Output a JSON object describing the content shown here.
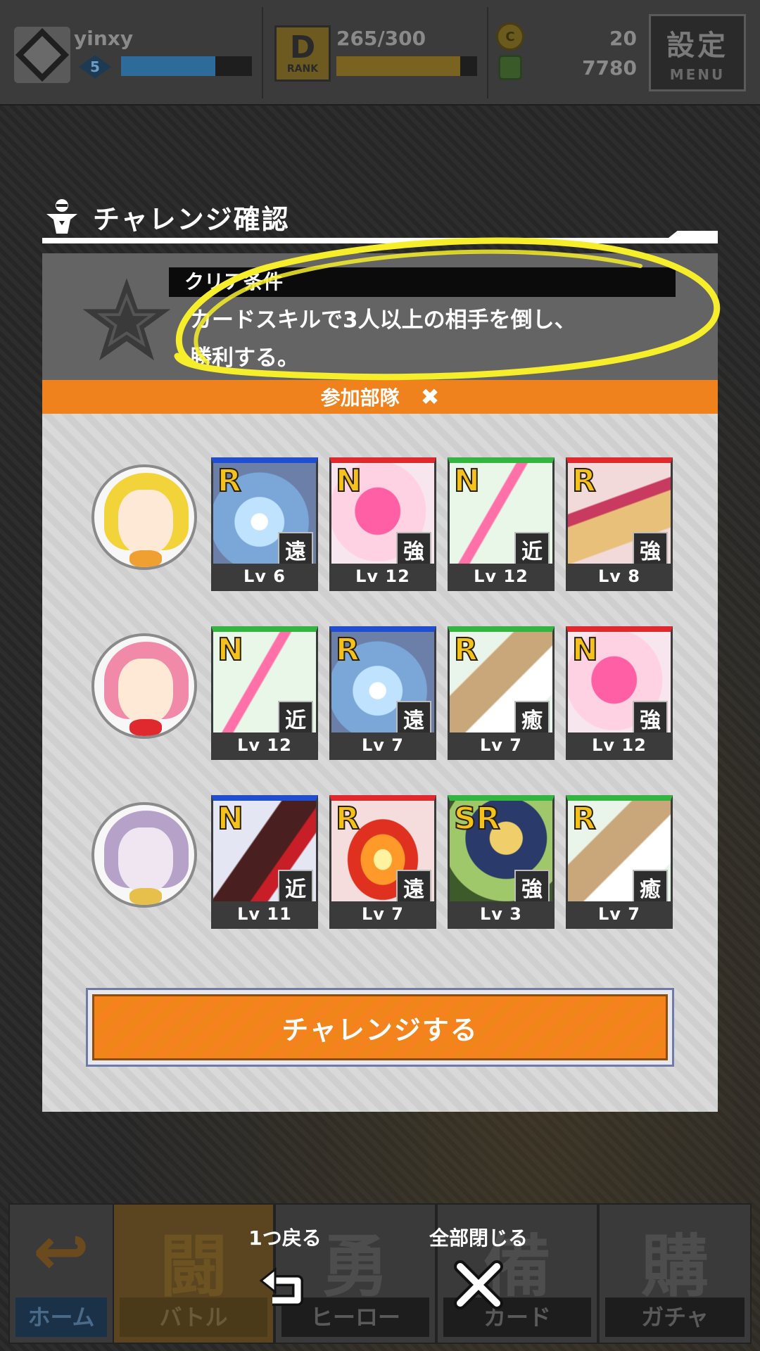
{
  "header": {
    "user_name": "yinxy",
    "level": "5",
    "level_progress": 0.72,
    "rank_glyph": "D",
    "rank_label": "RANK",
    "stamina": "265/300",
    "stamina_progress": 0.88,
    "coin_symbol": "C",
    "coins": "20",
    "gems": "7780",
    "settings_label": "設定",
    "menu_label": "MENU"
  },
  "dialog": {
    "title": "チャレンジ確認",
    "condition_header": "クリア条件",
    "condition_line1": "カードスキルで3人以上の相手を倒し、",
    "condition_line2": "勝利する。",
    "party_strip_label": "参加部隊",
    "party_strip_close": "✖",
    "challenge_button": "チャレンジする"
  },
  "team": [
    {
      "hero": "yellow-hooded-hero",
      "cards": [
        {
          "rarity": "R",
          "type": "遠",
          "level": "Lv 6",
          "color": "#1f4fd0",
          "art": "ice-shards"
        },
        {
          "rarity": "N",
          "type": "強",
          "level": "Lv 12",
          "color": "#e0282f",
          "art": "pink-umbrella"
        },
        {
          "rarity": "N",
          "type": "近",
          "level": "Lv 12",
          "color": "#33b540",
          "art": "magic-wand"
        },
        {
          "rarity": "R",
          "type": "強",
          "level": "Lv 8",
          "color": "#e0282f",
          "art": "cleaning-tools"
        }
      ]
    },
    {
      "hero": "pink-haired-hero",
      "cards": [
        {
          "rarity": "N",
          "type": "近",
          "level": "Lv 12",
          "color": "#33b540",
          "art": "magic-wand"
        },
        {
          "rarity": "R",
          "type": "遠",
          "level": "Lv 7",
          "color": "#1f4fd0",
          "art": "ice-shards"
        },
        {
          "rarity": "R",
          "type": "癒",
          "level": "Lv 7",
          "color": "#33b540",
          "art": "medical-kit"
        },
        {
          "rarity": "N",
          "type": "強",
          "level": "Lv 12",
          "color": "#e0282f",
          "art": "pink-umbrella"
        }
      ]
    },
    {
      "hero": "purple-haired-hero",
      "cards": [
        {
          "rarity": "N",
          "type": "近",
          "level": "Lv 11",
          "color": "#1f4fd0",
          "art": "chainsaw"
        },
        {
          "rarity": "R",
          "type": "遠",
          "level": "Lv 7",
          "color": "#e0282f",
          "art": "flame-hand"
        },
        {
          "rarity": "SR",
          "type": "強",
          "level": "Lv 3",
          "color": "#33b540",
          "art": "blonde-fighter"
        },
        {
          "rarity": "R",
          "type": "癒",
          "level": "Lv 7",
          "color": "#33b540",
          "art": "medical-kit"
        }
      ]
    }
  ],
  "overlay": {
    "back_label": "1つ戻る",
    "close_all_label": "全部閉じる"
  },
  "nav": {
    "home_big": "↩",
    "home": "ホーム",
    "battle_big": "闘",
    "battle": "バトル",
    "hero_big": "勇",
    "hero": "ヒーロー",
    "card_big": "備",
    "card": "カード",
    "gacha_big": "購",
    "gacha": "ガチャ"
  },
  "colors": {
    "accent_orange": "#f0821e",
    "annotation_yellow": "#f6ee2a"
  }
}
